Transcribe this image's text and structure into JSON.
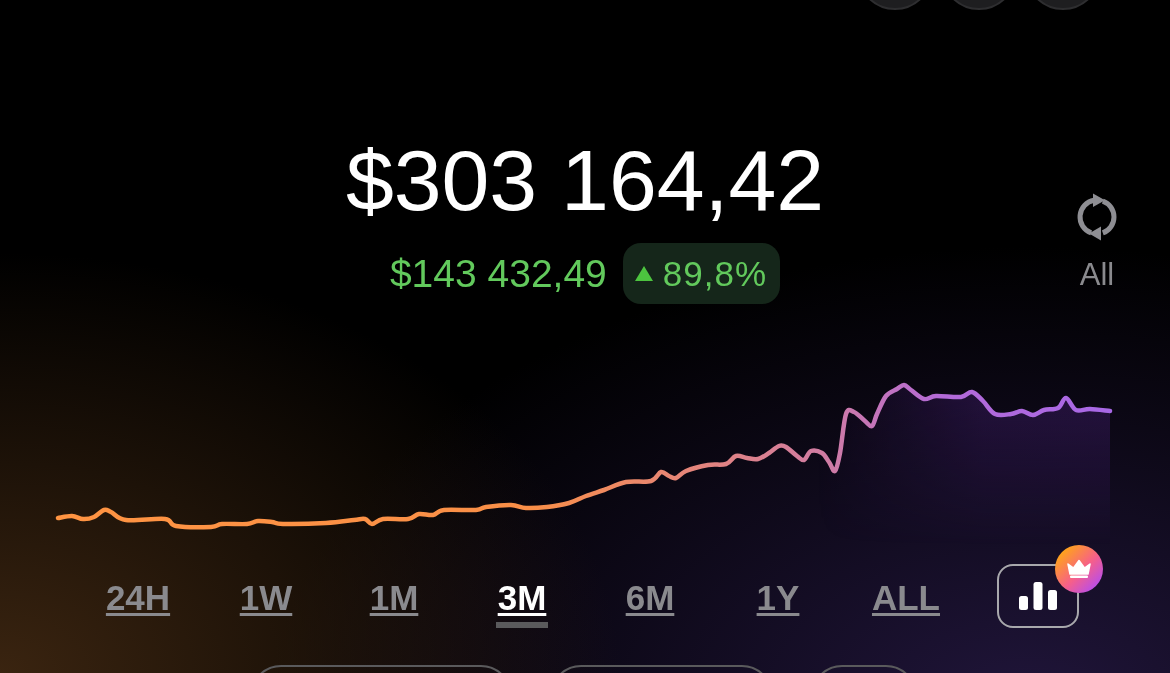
{
  "top_buttons": [
    {
      "kind": "round"
    },
    {
      "kind": "round"
    },
    {
      "kind": "round"
    }
  ],
  "balance": {
    "value": "$303 164,42",
    "change": "$143 432,49",
    "change_percent": {
      "positive": true,
      "text": "89,8%"
    }
  },
  "sync": {
    "label": "All"
  },
  "time_ranges": [
    {
      "label": "24H",
      "selected": false
    },
    {
      "label": "1W",
      "selected": false
    },
    {
      "label": "1M",
      "selected": false
    },
    {
      "label": "3M",
      "selected": true
    },
    {
      "label": "6M",
      "selected": false
    },
    {
      "label": "1Y",
      "selected": false
    },
    {
      "label": "ALL",
      "selected": false
    }
  ],
  "chart_type_button": {
    "premium": true
  },
  "bottom_buttons": [
    {
      "kind": "pill"
    },
    {
      "kind": "pill"
    },
    {
      "kind": "pill"
    }
  ]
}
